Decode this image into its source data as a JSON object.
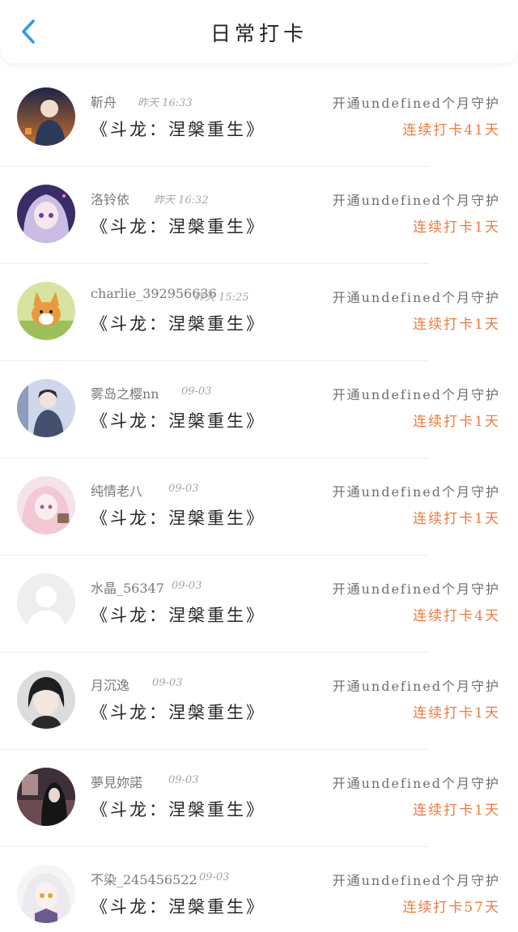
{
  "header": {
    "title": "日常打卡",
    "back_icon": "chevron-left-icon",
    "accent_color": "#2e9bf0"
  },
  "colors": {
    "streak": "#ee7a3e",
    "meta": "#6e6e6e"
  },
  "entries": [
    {
      "name": "靳舟",
      "time": "昨天 16:33",
      "book": "《斗龙：涅槃重生》",
      "guard": "开通undefined个月守护",
      "streak": "连续打卡41天",
      "avatar": "avatar-anime-boy-night"
    },
    {
      "name": "洛铃依",
      "time": "昨天 16:32",
      "book": "《斗龙：涅槃重生》",
      "guard": "开通undefined个月守护",
      "streak": "连续打卡1天",
      "avatar": "avatar-anime-girl-purple"
    },
    {
      "name": "charlie_392956636",
      "time": "昨天 15:25",
      "book": "《斗龙：涅槃重生》",
      "guard": "开通undefined个月守护",
      "streak": "连续打卡1天",
      "avatar": "avatar-corgi-dog"
    },
    {
      "name": "雾岛之樱nn",
      "time": "09-03",
      "book": "《斗龙：涅槃重生》",
      "guard": "开通undefined个月守护",
      "streak": "连续打卡1天",
      "avatar": "avatar-anime-winter"
    },
    {
      "name": "纯情老八",
      "time": "09-03",
      "book": "《斗龙：涅槃重生》",
      "guard": "开通undefined个月守护",
      "streak": "连续打卡1天",
      "avatar": "avatar-anime-girl-pink"
    },
    {
      "name": "水晶_56347",
      "time": "09-03",
      "book": "《斗龙：涅槃重生》",
      "guard": "开通undefined个月守护",
      "streak": "连续打卡4天",
      "avatar": "avatar-default-placeholder"
    },
    {
      "name": "月沉逸",
      "time": "09-03",
      "book": "《斗龙：涅槃重生》",
      "guard": "开通undefined个月守护",
      "streak": "连续打卡1天",
      "avatar": "avatar-anime-boy-dark-hair"
    },
    {
      "name": "夢見妳諾",
      "time": "09-03",
      "book": "《斗龙：涅槃重生》",
      "guard": "开通undefined个月守护",
      "streak": "连续打卡1天",
      "avatar": "avatar-anime-dark-room"
    },
    {
      "name": "不染_245456522",
      "time": "09-03",
      "book": "《斗龙：涅槃重生》",
      "guard": "开通undefined个月守护",
      "streak": "连续打卡57天",
      "avatar": "avatar-anime-white-hair"
    }
  ]
}
